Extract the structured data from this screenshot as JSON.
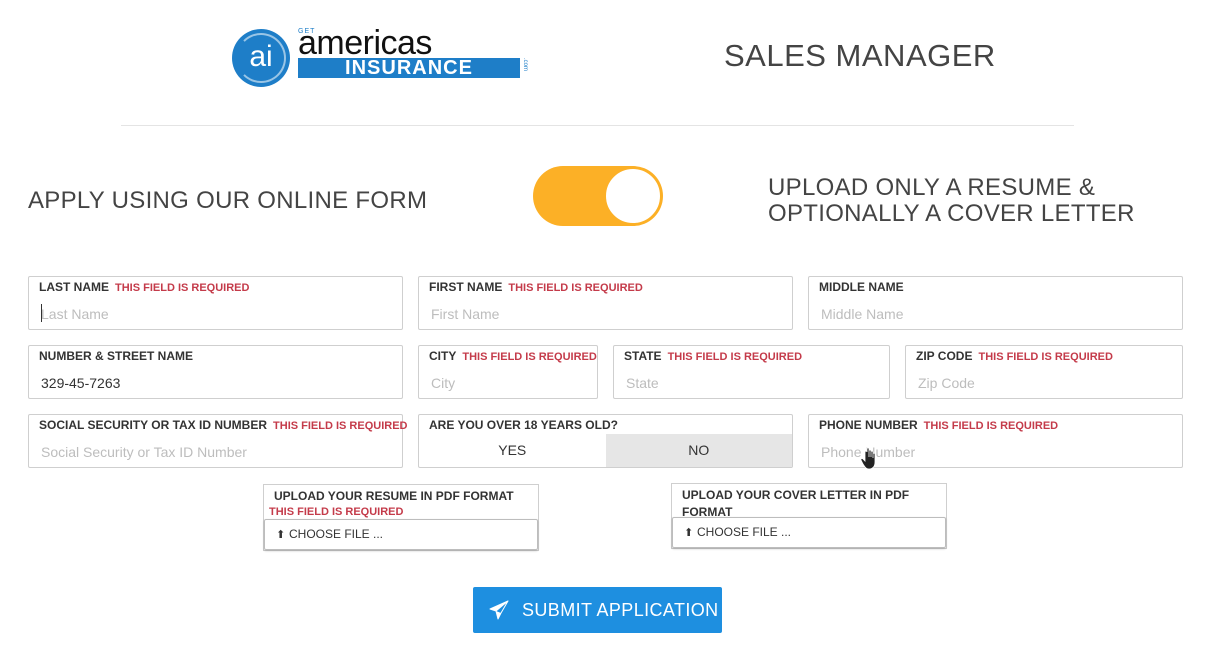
{
  "header": {
    "logo": {
      "get": "GET",
      "top": "americas",
      "bottom": "INSURANCE",
      "com": ".com",
      "mark": "ai"
    },
    "job_title": "SALES MANAGER"
  },
  "mode": {
    "left_label": "APPLY USING OUR ONLINE FORM",
    "right_label_line1": "UPLOAD ONLY A RESUME &",
    "right_label_line2": "OPTIONALLY A COVER LETTER",
    "toggle_color": "#fcb026"
  },
  "form": {
    "required_text": "THIS FIELD IS REQUIRED",
    "last_name": {
      "label": "LAST NAME",
      "placeholder": "Last Name",
      "value": ""
    },
    "first_name": {
      "label": "FIRST NAME",
      "placeholder": "First Name",
      "value": ""
    },
    "middle_name": {
      "label": "MIDDLE NAME",
      "placeholder": "Middle Name",
      "value": ""
    },
    "street": {
      "label": "NUMBER & STREET NAME",
      "placeholder": "",
      "value": "329-45-7263"
    },
    "city": {
      "label": "CITY",
      "placeholder": "City",
      "value": ""
    },
    "state": {
      "label": "STATE",
      "placeholder": "State",
      "value": ""
    },
    "zip": {
      "label": "ZIP CODE",
      "placeholder": "Zip Code",
      "value": ""
    },
    "ssn": {
      "label": "SOCIAL SECURITY OR TAX ID NUMBER",
      "placeholder": "Social Security or Tax ID Number",
      "value": ""
    },
    "over18": {
      "label": "ARE YOU OVER 18 YEARS OLD?",
      "yes": "YES",
      "no": "NO"
    },
    "phone": {
      "label": "PHONE NUMBER",
      "placeholder": "Phone Number",
      "value": ""
    },
    "resume": {
      "label": "UPLOAD YOUR RESUME IN PDF FORMAT",
      "button": "CHOOSE FILE ..."
    },
    "cover": {
      "label_line1": "UPLOAD YOUR COVER LETTER IN PDF",
      "label_line2": "FORMAT",
      "button": "CHOOSE FILE ..."
    },
    "submit": "SUBMIT APPLICATION"
  },
  "colors": {
    "accent": "#1e8fe0",
    "required": "#c43b4a",
    "brand_blue": "#1e7ec8"
  }
}
